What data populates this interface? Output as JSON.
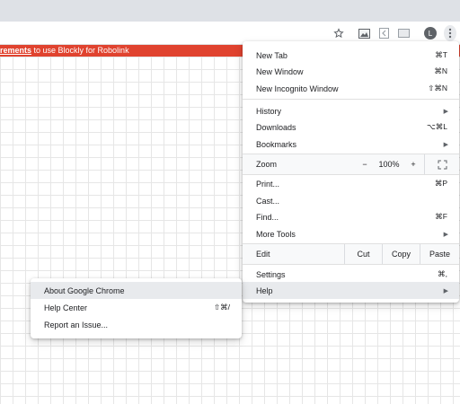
{
  "toolbar": {
    "bookmark_icon": "star-icon",
    "ext1_icon": "image-icon",
    "ext2_icon": "blockly-icon",
    "ext3_icon": "cast-icon",
    "avatar_letter": "L",
    "menu_icon": "kebab-menu-icon"
  },
  "banner": {
    "link_text": "rements",
    "text": " to use Blockly for Robolink",
    "color": "#e0432f"
  },
  "main_menu": {
    "new_tab": {
      "label": "New Tab",
      "shortcut": "⌘T"
    },
    "new_window": {
      "label": "New Window",
      "shortcut": "⌘N"
    },
    "new_incognito": {
      "label": "New Incognito Window",
      "shortcut": "⇧⌘N"
    },
    "history": {
      "label": "History"
    },
    "downloads": {
      "label": "Downloads",
      "shortcut": "⌥⌘L"
    },
    "bookmarks": {
      "label": "Bookmarks"
    },
    "zoom": {
      "label": "Zoom",
      "minus": "−",
      "value": "100%",
      "plus": "+"
    },
    "print": {
      "label": "Print...",
      "shortcut": "⌘P"
    },
    "cast": {
      "label": "Cast..."
    },
    "find": {
      "label": "Find...",
      "shortcut": "⌘F"
    },
    "more_tools": {
      "label": "More Tools"
    },
    "edit": {
      "label": "Edit",
      "cut": "Cut",
      "copy": "Copy",
      "paste": "Paste"
    },
    "settings": {
      "label": "Settings",
      "shortcut": "⌘,"
    },
    "help": {
      "label": "Help"
    }
  },
  "help_menu": {
    "about": {
      "label": "About Google Chrome"
    },
    "help_center": {
      "label": "Help Center",
      "shortcut": "⇧⌘/"
    },
    "report_issue": {
      "label": "Report an Issue..."
    }
  }
}
